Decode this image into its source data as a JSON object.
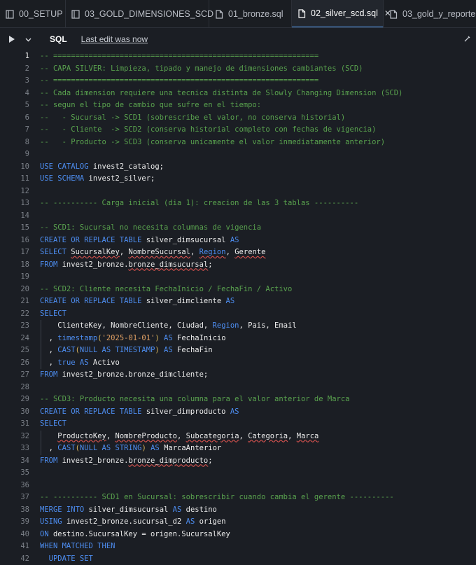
{
  "tabs": [
    {
      "label": "00_SETUP",
      "icon": "notebook-icon",
      "active": false
    },
    {
      "label": "03_GOLD_DIMENSIONES_SCD",
      "icon": "notebook-icon",
      "active": false
    },
    {
      "label": "01_bronze.sql",
      "icon": "file-icon",
      "active": false
    },
    {
      "label": "02_silver_scd.sql",
      "icon": "file-icon",
      "active": true
    },
    {
      "label": "03_gold_y_reporte.sq",
      "icon": "file-icon",
      "active": false
    }
  ],
  "toolbar": {
    "language": "SQL",
    "last_edit": "Last edit was now"
  },
  "current_line": 1,
  "line_numbers": [
    "1",
    "2",
    "3",
    "4",
    "5",
    "6",
    "7",
    "8",
    "9",
    "10",
    "11",
    "12",
    "13",
    "14",
    "15",
    "16",
    "17",
    "18",
    "19",
    "20",
    "21",
    "22",
    "23",
    "24",
    "25",
    "26",
    "27",
    "28",
    "29",
    "30",
    "31",
    "32",
    "33",
    "34",
    "35",
    "36",
    "37",
    "38",
    "39",
    "40",
    "41",
    "42"
  ],
  "code_lines": [
    [
      [
        "c",
        "-- ============================================================"
      ]
    ],
    [
      [
        "c",
        "-- CAPA SILVER: Limpieza, tipado y manejo de dimensiones cambiantes (SCD)"
      ]
    ],
    [
      [
        "c",
        "-- ============================================================"
      ]
    ],
    [
      [
        "c",
        "-- Cada dimension requiere una tecnica distinta de Slowly Changing Dimension (SCD)"
      ]
    ],
    [
      [
        "c",
        "-- segun el tipo de cambio que sufre en el tiempo:"
      ]
    ],
    [
      [
        "c",
        "--   - Sucursal -> SCD1 (sobrescribe el valor, no conserva historial)"
      ]
    ],
    [
      [
        "c",
        "--   - Cliente  -> SCD2 (conserva historial completo con fechas de vigencia)"
      ]
    ],
    [
      [
        "c",
        "--   - Producto -> SCD3 (conserva unicamente el valor inmediatamente anterior)"
      ]
    ],
    [],
    [
      [
        "k",
        "USE CATALOG "
      ],
      [
        "t",
        "invest2_catalog;"
      ]
    ],
    [
      [
        "k",
        "USE SCHEMA "
      ],
      [
        "t",
        "invest2_silver;"
      ]
    ],
    [],
    [
      [
        "c",
        "-- ---------- Carga inicial (dia 1): creacion de las 3 tablas ----------"
      ]
    ],
    [],
    [
      [
        "c",
        "-- SCD1: Sucursal no necesita columnas de vigencia"
      ]
    ],
    [
      [
        "k",
        "CREATE OR REPLACE TABLE "
      ],
      [
        "t",
        "silver_dimsucursal "
      ],
      [
        "k",
        "AS"
      ]
    ],
    [
      [
        "k",
        "SELECT "
      ],
      [
        "tw",
        "SucursalKey"
      ],
      [
        "t",
        ", "
      ],
      [
        "tw",
        "NombreSucursal"
      ],
      [
        "t",
        ", "
      ],
      [
        "kw",
        "Region"
      ],
      [
        "t",
        ", "
      ],
      [
        "tw",
        "Gerente"
      ]
    ],
    [
      [
        "k",
        "FROM "
      ],
      [
        "t",
        "invest2_bronze."
      ],
      [
        "tw",
        "bronze_dimsucursal"
      ],
      [
        "t",
        ";"
      ]
    ],
    [],
    [
      [
        "c",
        "-- SCD2: Cliente necesita FechaInicio / FechaFin / Activo"
      ]
    ],
    [
      [
        "k",
        "CREATE OR REPLACE TABLE "
      ],
      [
        "t",
        "silver_dimcliente "
      ],
      [
        "k",
        "AS"
      ]
    ],
    [
      [
        "k",
        "SELECT"
      ]
    ],
    [
      [
        "t",
        "    ClienteKey, NombreCliente, Ciudad, "
      ],
      [
        "k",
        "Region"
      ],
      [
        "t",
        ", Pais, Email"
      ]
    ],
    [
      [
        "t",
        "  , "
      ],
      [
        "k",
        "timestamp"
      ],
      [
        "f",
        "("
      ],
      [
        "s",
        "'2025-01-01'"
      ],
      [
        "f",
        ")"
      ],
      [
        "k",
        " AS "
      ],
      [
        "t",
        "FechaInicio"
      ]
    ],
    [
      [
        "t",
        "  , "
      ],
      [
        "k",
        "CAST"
      ],
      [
        "f",
        "("
      ],
      [
        "k",
        "NULL AS TIMESTAMP"
      ],
      [
        "f",
        ")"
      ],
      [
        "k",
        " AS "
      ],
      [
        "t",
        "FechaFin"
      ]
    ],
    [
      [
        "t",
        "  , "
      ],
      [
        "k",
        "true AS "
      ],
      [
        "t",
        "Activo"
      ]
    ],
    [
      [
        "k",
        "FROM "
      ],
      [
        "t",
        "invest2_bronze.bronze_dimcliente;"
      ]
    ],
    [],
    [
      [
        "c",
        "-- SCD3: Producto necesita una columna para el valor anterior de Marca"
      ]
    ],
    [
      [
        "k",
        "CREATE OR REPLACE TABLE "
      ],
      [
        "t",
        "silver_dimproducto "
      ],
      [
        "k",
        "AS"
      ]
    ],
    [
      [
        "k",
        "SELECT"
      ]
    ],
    [
      [
        "t",
        "    "
      ],
      [
        "tw",
        "ProductoKey"
      ],
      [
        "t",
        ", "
      ],
      [
        "tw",
        "NombreProducto"
      ],
      [
        "t",
        ", "
      ],
      [
        "tw",
        "Subcategoria"
      ],
      [
        "t",
        ", "
      ],
      [
        "tw",
        "Categoria"
      ],
      [
        "t",
        ", "
      ],
      [
        "tw",
        "Marca"
      ]
    ],
    [
      [
        "t",
        "  , "
      ],
      [
        "k",
        "CAST"
      ],
      [
        "f",
        "("
      ],
      [
        "k",
        "NULL AS STRING"
      ],
      [
        "f",
        ")"
      ],
      [
        "k",
        " AS "
      ],
      [
        "t",
        "MarcaAnterior"
      ]
    ],
    [
      [
        "k",
        "FROM "
      ],
      [
        "t",
        "invest2_bronze."
      ],
      [
        "tw",
        "bronze_dimproducto"
      ],
      [
        "t",
        ";"
      ]
    ],
    [],
    [],
    [
      [
        "c",
        "-- ---------- SCD1 en Sucursal: sobrescribir cuando cambia el gerente ----------"
      ]
    ],
    [
      [
        "k",
        "MERGE INTO "
      ],
      [
        "t",
        "silver_dimsucursal "
      ],
      [
        "k",
        "AS "
      ],
      [
        "t",
        "destino"
      ]
    ],
    [
      [
        "k",
        "USING "
      ],
      [
        "t",
        "invest2_bronze.sucursal_d2 "
      ],
      [
        "k",
        "AS "
      ],
      [
        "t",
        "origen"
      ]
    ],
    [
      [
        "k",
        "ON "
      ],
      [
        "t",
        "destino.SucursalKey = origen.SucursalKey"
      ]
    ],
    [
      [
        "k",
        "WHEN MATCHED THEN"
      ]
    ],
    [
      [
        "k",
        "  UPDATE SET"
      ]
    ]
  ],
  "indent_guide_lines": [
    23,
    32
  ]
}
